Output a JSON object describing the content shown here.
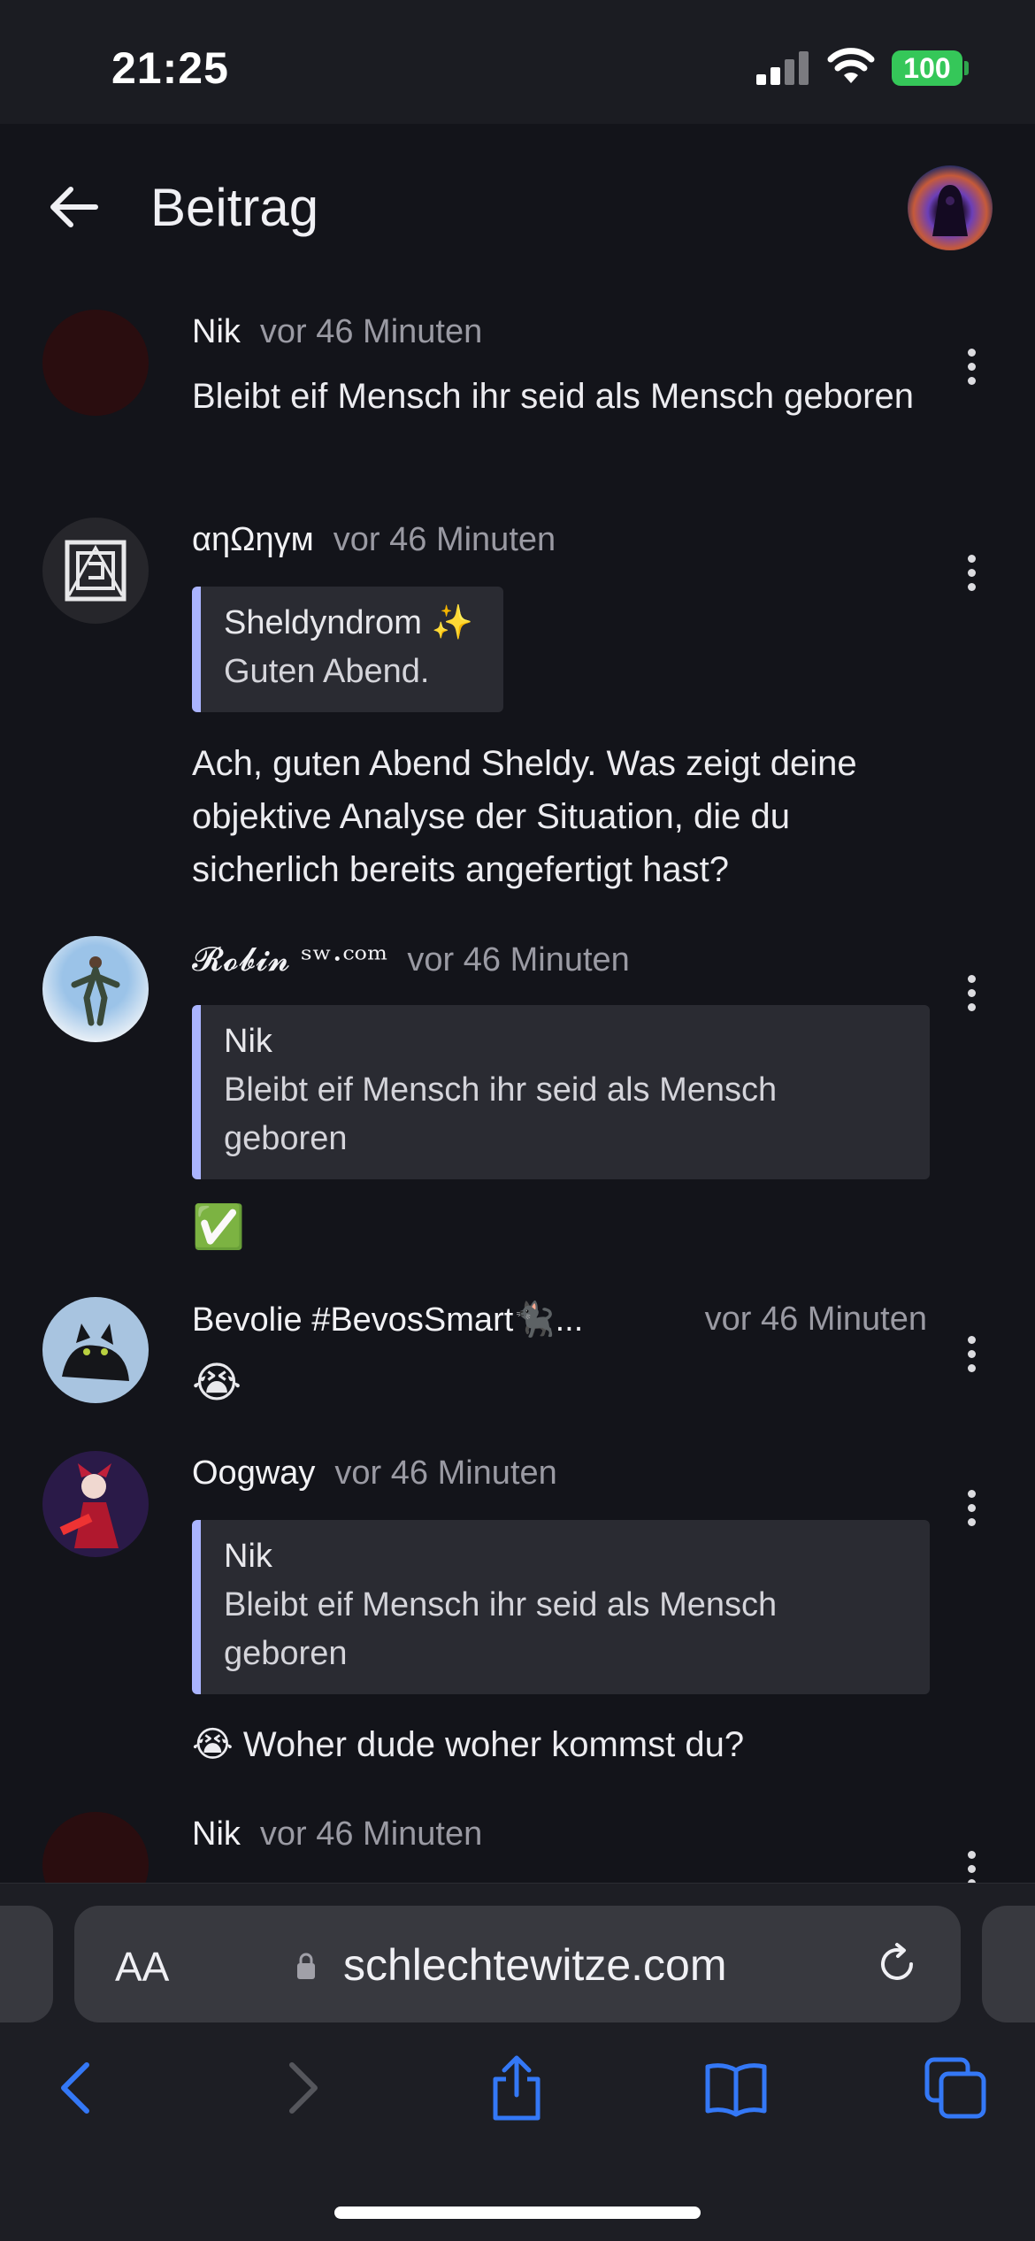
{
  "status_bar": {
    "time": "21:25",
    "battery": "100"
  },
  "header": {
    "title": "Beitrag"
  },
  "posts": [
    {
      "author": "Nik",
      "time": "vor 46 Minuten",
      "text": "Bleibt eif Mensch ihr seid als Mensch geboren"
    },
    {
      "author": "αηΩηγм",
      "time": "vor 46 Minuten",
      "quote": {
        "author": "Sheldyndrom ✨",
        "text": "Guten Abend."
      },
      "text": "Ach, guten Abend Sheldy. Was zeigt deine objektive Analyse der Situation, die du sicherlich bereits angefertigt hast?"
    },
    {
      "author": "𝓡𝓸𝓫𝓲𝓷 ˢʷ·ᶜᵒᵐ",
      "time": "vor 46 Minuten",
      "quote": {
        "author": "Nik",
        "text": "Bleibt eif Mensch ihr seid als Mensch geboren"
      },
      "text": "✅"
    },
    {
      "author": "Bevolie #BevosSmart🐈‍⬛...",
      "time": "vor 46 Minuten",
      "text": "😭"
    },
    {
      "author": "Oogway",
      "time": "vor 46 Minuten",
      "quote": {
        "author": "Nik",
        "text": "Bleibt eif Mensch ihr seid als Mensch geboren"
      },
      "text": "😭 Woher dude woher kommst du?"
    },
    {
      "author": "Nik",
      "time": "vor 46 Minuten"
    }
  ],
  "browser": {
    "aa_label": "AA",
    "url": "schlechtewitze.com"
  },
  "icons": {
    "back": "back-arrow-icon",
    "menu": "more-vertical-icon",
    "lock": "lock-icon",
    "reload": "reload-icon",
    "nav_back": "chevron-left-icon",
    "nav_forward": "chevron-right-icon",
    "share": "share-icon",
    "bookmarks": "book-icon",
    "tabs": "tabs-icon"
  },
  "colors": {
    "background": "#13141a",
    "accent": "#3478f6",
    "quote_bar": "#aab4ff",
    "battery": "#35c759"
  }
}
